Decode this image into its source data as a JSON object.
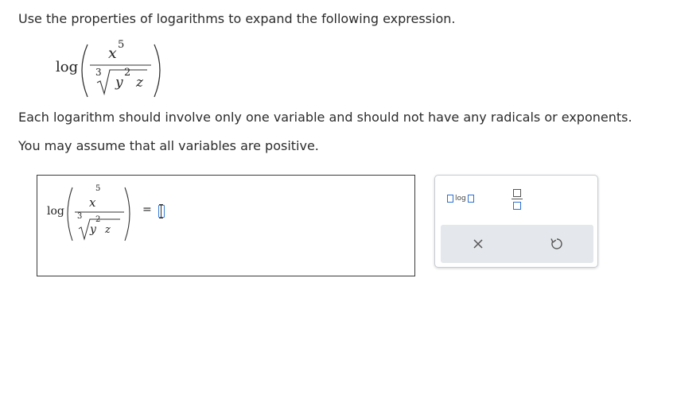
{
  "question": {
    "instruction": "Use the properties of logarithms to expand the following expression.",
    "note_1": "Each logarithm should involve only one variable and should not have any radicals or exponents.",
    "note_2": "You may assume that all variables are positive.",
    "expression": {
      "function": "log",
      "numerator_base": "x",
      "numerator_exponent": "5",
      "root_index": "3",
      "radicand_base": "y",
      "radicand_exponent": "2",
      "radicand_factor": "z"
    }
  },
  "answer": {
    "expression": {
      "function": "log",
      "numerator_base": "x",
      "numerator_exponent": "5",
      "root_index": "3",
      "radicand_base": "y",
      "radicand_exponent": "2",
      "radicand_factor": "z"
    },
    "equals": "="
  },
  "toolbar": {
    "log_button_label": "log",
    "clear_symbol": "×",
    "accent_color": "#2d6fd2"
  }
}
